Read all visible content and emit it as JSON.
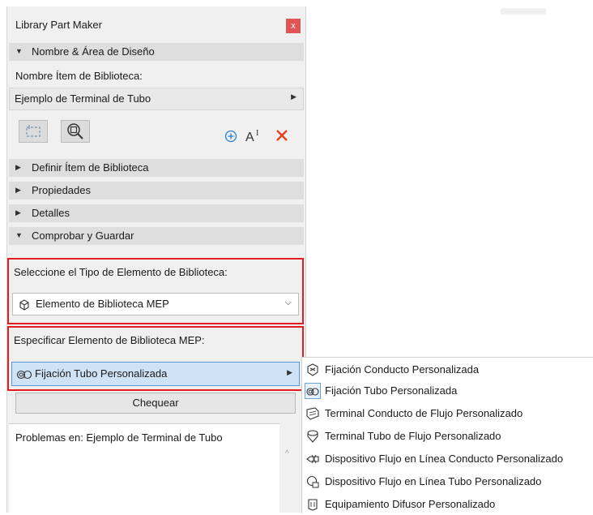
{
  "panel": {
    "title": "Library Part Maker",
    "close_label": "x",
    "section_nombre": "Nombre & Área de Diseño",
    "nombre_label": "Nombre Ítem de Biblioteca:",
    "nombre_value": "Ejemplo de Terminal de Tubo",
    "section_definir": "Definir Ítem de Biblioteca",
    "section_propiedades": "Propiedades",
    "section_detalles": "Detalles",
    "section_comprobar": "Comprobar y Guardar",
    "tipo_label": "Seleccione el Tipo de Elemento de Biblioteca:",
    "tipo_value": "Elemento de Biblioteca MEP",
    "especificar_label": "Especificar Elemento de Biblioteca MEP:",
    "especificar_value": "Fijación Tubo Personalizada",
    "chequear_label": "Chequear",
    "problemas_text": "Problemas en: Ejemplo de Terminal de Tubo"
  },
  "submenu": {
    "items": [
      {
        "label": "Fijación Conducto Personalizada",
        "icon": "duct-fitting-icon"
      },
      {
        "label": "Fijación Tubo Personalizada",
        "icon": "pipe-fitting-icon"
      },
      {
        "label": "Terminal Conducto de Flujo Personalizado",
        "icon": "duct-terminal-icon"
      },
      {
        "label": "Terminal Tubo de Flujo Personalizado",
        "icon": "pipe-terminal-icon"
      },
      {
        "label": "Dispositivo Flujo en Línea Conducto Personalizado",
        "icon": "duct-inline-icon"
      },
      {
        "label": "Dispositivo Flujo en Línea Tubo Personalizado",
        "icon": "pipe-inline-icon"
      },
      {
        "label": "Equipamiento Difusor Personalizado",
        "icon": "diffuser-icon"
      }
    ]
  },
  "colors": {
    "highlight_red": "#e02020",
    "selected_blue": "#cfe3f7",
    "delete_red": "#e8401c",
    "add_blue": "#2a7fd4"
  }
}
